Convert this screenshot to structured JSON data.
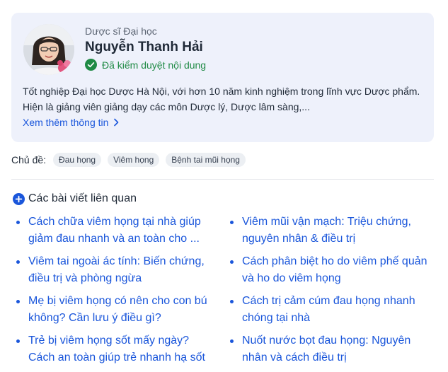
{
  "author": {
    "role": "Dược sĩ Đại học",
    "name": "Nguyễn Thanh Hải",
    "verified_label": "Đã kiểm duyệt nội dung",
    "bio": "Tốt nghiệp Đại học Dược Hà Nội, với hơn 10 năm kinh nghiệm trong lĩnh vực Dược phẩm. Hiện là giảng viên giảng dạy các môn Dược lý, Dược lâm sàng,...",
    "more_label": "Xem thêm thông tin"
  },
  "topics": {
    "label": "Chủ đề:",
    "chips": [
      "Đau họng",
      "Viêm họng",
      "Bệnh tai mũi họng"
    ]
  },
  "related": {
    "title": "Các bài viết liên quan",
    "left": [
      "Cách chữa viêm họng tại nhà giúp giảm đau nhanh và an toàn cho ...",
      "Viêm tai ngoài ác tính: Biến chứng, điều trị và phòng ngừa",
      "Mẹ bị viêm họng có nên cho con bú không? Cần lưu ý điều gì?",
      "Trẻ bị viêm họng sốt mấy ngày? Cách an toàn giúp trẻ nhanh hạ sốt"
    ],
    "right": [
      "Viêm mũi vận mạch: Triệu chứng, nguyên nhân & điều trị",
      "Cách phân biệt ho do viêm phế quản và ho do viêm họng",
      "Cách trị cảm cúm đau họng nhanh chóng tại nhà",
      "Nuốt nước bọt đau họng: Nguyên nhân và cách điều trị"
    ]
  },
  "colors": {
    "card_bg": "#eef1fb",
    "link": "#1a56db",
    "verified": "#1f8a45",
    "chip_bg": "#eceff3"
  },
  "icons": {
    "verified": "check-circle-icon",
    "more": "chevron-right-icon",
    "related": "plus-circle-icon"
  }
}
